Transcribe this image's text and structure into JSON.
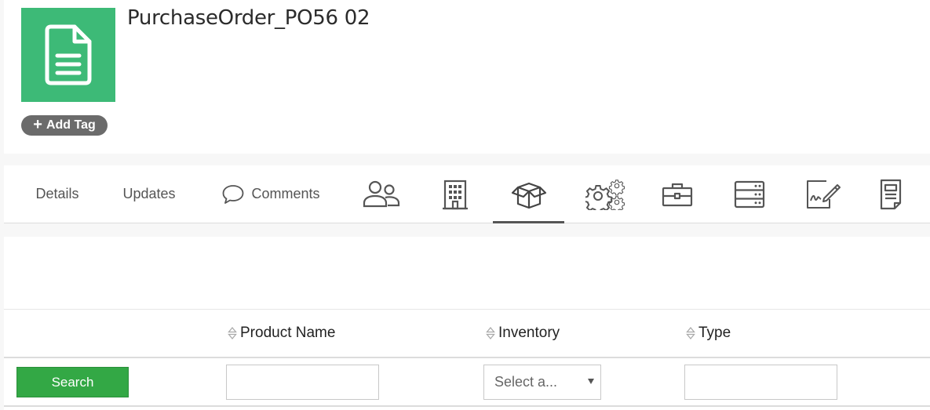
{
  "record": {
    "title": "PurchaseOrder_PO56 02",
    "icon": "document-icon",
    "accent_color": "#3dba77"
  },
  "tag": {
    "add_label": "Add Tag",
    "icon": "plus-icon"
  },
  "tabs": [
    {
      "label": "Details"
    },
    {
      "label": "Updates"
    },
    {
      "label": "Comments",
      "icon": "comment-bubble-icon"
    },
    {
      "icon": "users-icon"
    },
    {
      "icon": "building-icon"
    },
    {
      "icon": "package-icon",
      "active": true
    },
    {
      "icon": "gears-icon"
    },
    {
      "icon": "briefcase-icon"
    },
    {
      "icon": "server-icon"
    },
    {
      "icon": "signature-icon"
    },
    {
      "icon": "document-list-icon"
    }
  ],
  "table": {
    "columns": [
      "Product Name",
      "Inventory",
      "Type"
    ],
    "search_label": "Search",
    "inventory_select_value": "Select a...",
    "button_color": "#33a845"
  }
}
